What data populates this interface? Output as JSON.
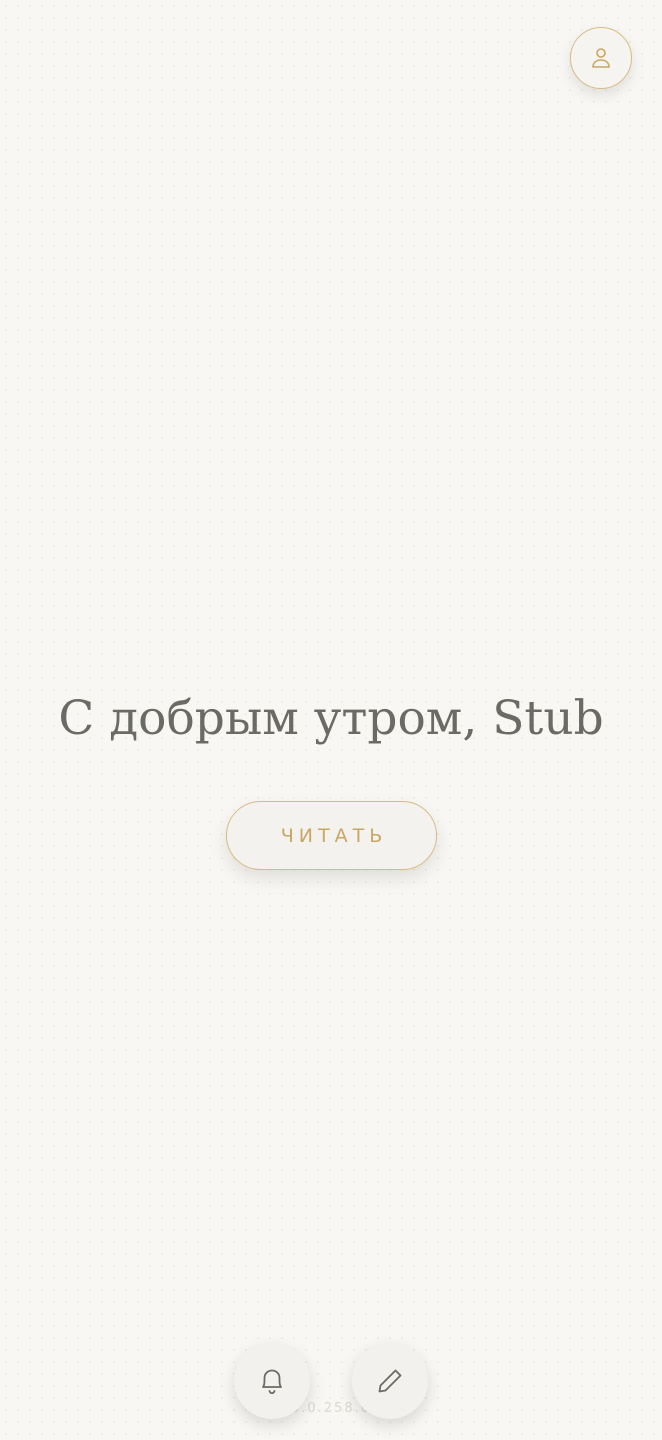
{
  "header": {
    "profile_icon": "user-icon"
  },
  "main": {
    "greeting": "С добрым утром, Stub",
    "read_button_label": "ЧИТАТЬ"
  },
  "footer": {
    "version": "0.0.258.0",
    "notifications_icon": "bell-icon",
    "compose_icon": "pencil-icon"
  },
  "colors": {
    "background": "#f8f7f4",
    "accent": "#c9a762",
    "accent_border": "#d9bb82",
    "text": "#6b6b66"
  }
}
